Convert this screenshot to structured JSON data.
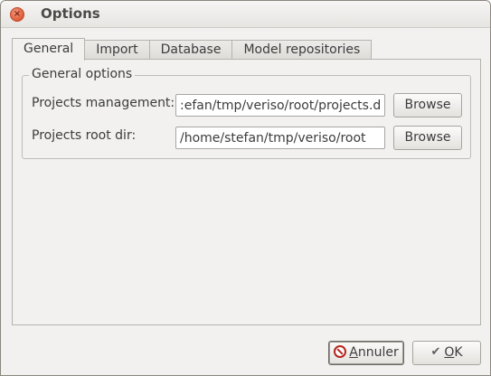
{
  "window": {
    "title": "Options",
    "close_glyph": "×"
  },
  "tabs": [
    {
      "label": "General",
      "active": true
    },
    {
      "label": "Import",
      "active": false
    },
    {
      "label": "Database",
      "active": false
    },
    {
      "label": "Model repositories",
      "active": false
    }
  ],
  "general": {
    "group_title": "General options",
    "projects_management": {
      "label": "Projects management:",
      "value": ":efan/tmp/veriso/root/projects.db",
      "browse_label": "Browse"
    },
    "projects_root": {
      "label": "Projects root dir:",
      "value": "/home/stefan/tmp/veriso/root",
      "browse_label": "Browse"
    }
  },
  "footer": {
    "cancel": {
      "prefix": "",
      "mnemonic": "A",
      "rest": "nnuler",
      "icon": "cancel-icon"
    },
    "ok": {
      "mnemonic": "O",
      "rest": "K",
      "icon": "check-icon"
    }
  },
  "colors": {
    "close_button": "#e05b37",
    "cancel_icon": "#b3261e"
  }
}
